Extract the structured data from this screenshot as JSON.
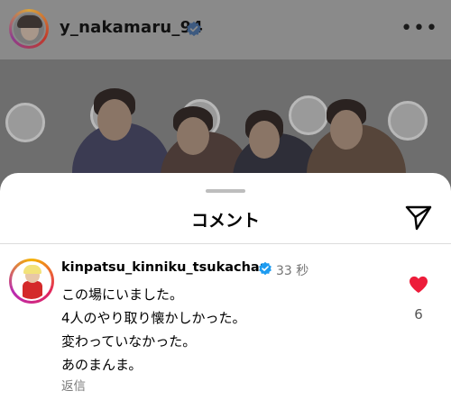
{
  "profile": {
    "username": "y_nakamaru_94",
    "more_icon": "more-horizontal-icon",
    "verified_icon": "verified-badge-icon"
  },
  "sheet": {
    "title": "コメント",
    "share_icon": "send-icon"
  },
  "comment": {
    "username": "kinpatsu_kinniku_tsukachan",
    "time": "33 秒",
    "lines": [
      "この場にいました。",
      "4人のやり取り懐かしかった。",
      "変わっていなかった。",
      "あのまんま。"
    ],
    "reply_label": "返信",
    "like_count": "6",
    "liked": true,
    "heart_color": "#ed1c3a",
    "verified_color": "#1d9bf0"
  }
}
